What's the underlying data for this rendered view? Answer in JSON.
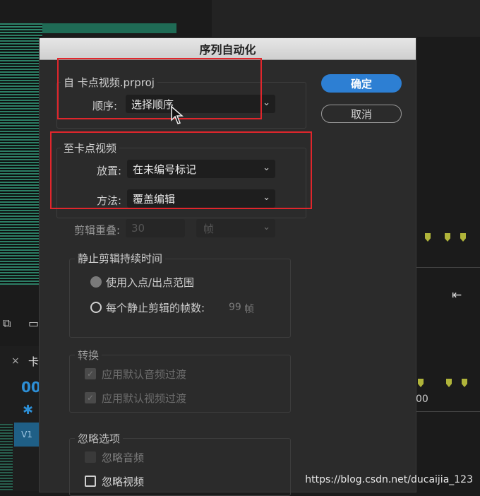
{
  "background": {
    "tab_close": "×",
    "tab_name": "卡",
    "timecode": "00",
    "track_label": "V1",
    "ruler_value": "00"
  },
  "dialog": {
    "title": "序列自动化",
    "from_group": {
      "legend": "自 卡点视频.prproj",
      "order_label": "顺序:",
      "order_value": "选择顺序"
    },
    "to_group": {
      "legend": "至卡点视频",
      "placement_label": "放置:",
      "placement_value": "在未编号标记",
      "method_label": "方法:",
      "method_value": "覆盖编辑"
    },
    "clip_overlap": {
      "label": "剪辑重叠:",
      "value": "30",
      "unit": "帧"
    },
    "still_duration": {
      "legend": "静止剪辑持续时间",
      "option_inout": "使用入点/出点范围",
      "option_frames": "每个静止剪辑的帧数:",
      "frames_value": "99",
      "frames_unit": "帧"
    },
    "transitions": {
      "legend": "转换",
      "audio": "应用默认音频过渡",
      "video": "应用默认视频过渡"
    },
    "ignore": {
      "legend": "忽略选项",
      "audio": "忽略音频",
      "video": "忽略视频"
    },
    "ok_label": "确定",
    "cancel_label": "取消"
  },
  "watermark": "https://blog.csdn.net/ducaijia_123",
  "colors": {
    "primary": "#2d7fd3",
    "highlight": "#e0262c",
    "marker": "#b0b43a"
  }
}
